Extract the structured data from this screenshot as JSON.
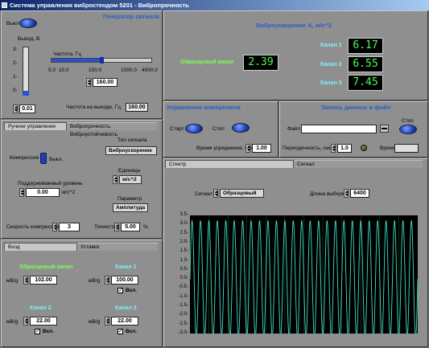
{
  "window": {
    "title": "Система управления вибростендом 5201 - Вибропрочность"
  },
  "generator": {
    "title": "Генератор сигнала",
    "power_label": "Выкл.",
    "output_label": "Выход, В",
    "y_ticks": [
      "3-",
      "2-",
      "1-",
      "0-"
    ],
    "output_value": "0.01",
    "freq_label": "Частота, Гц",
    "freq_ticks": [
      "5.0",
      "10.0",
      "100.0",
      "1000.0",
      "4000.0"
    ],
    "freq_value": "160.00",
    "freq_out_label": "Частота на выходе, Гц",
    "freq_out_value": "160.00"
  },
  "accel": {
    "title": "Виброускорение А, м/с^2",
    "ref_label": "Образцовый канал",
    "ref_value": "2.39",
    "channels": [
      {
        "label": "Канал 1",
        "value": "6.17"
      },
      {
        "label": "Канал 2",
        "value": "6.55"
      },
      {
        "label": "Канал 3",
        "value": "7.45"
      }
    ]
  },
  "measure": {
    "title": "Управление измерением",
    "start_label": "Старт",
    "stop_label": "Стоп",
    "avg_label": "Время усреднения, сек",
    "avg_value": "1.00"
  },
  "record": {
    "title": "Запись данных в файл",
    "stop_label": "Стоп",
    "file_label": "Файл",
    "file_value": "",
    "period_label": "Периодичность, сек",
    "period_value": "1.0",
    "time_label": "Время",
    "time_value": ""
  },
  "control": {
    "tabs": [
      "Ручное управление",
      "Вибропрочность. Виброустойчивость"
    ],
    "compression_label": "Компрессия",
    "off_label": "Выкл.",
    "level_label": "Поддерживаемый уровень",
    "level_value": "0.00",
    "level_unit": "м/с^2",
    "speed_label": "Скорость компрессии",
    "speed_value": "3",
    "signal_type_label": "Тип сигнала",
    "signal_type_value": "Виброускорение",
    "units_label": "Единицы",
    "units_value": "м/с^2",
    "param_label": "Параметр",
    "param_value": "Амплитуда",
    "accuracy_label": "Точность",
    "accuracy_value": "5.00",
    "accuracy_unit": "%"
  },
  "inputs": {
    "tabs": [
      "Вход",
      "Уставки"
    ],
    "unit": "мВ/g",
    "enabled_label": "Вкл.",
    "ref": {
      "label": "Образцовый канал",
      "value": "102.00"
    },
    "ch1": {
      "label": "Канал 1",
      "value": "100.00",
      "checked": "✓"
    },
    "ch2": {
      "label": "Канал 2",
      "value": "22.00",
      "checked": "✓"
    },
    "ch3": {
      "label": "Канал 3",
      "value": "22.00",
      "checked": "✓"
    }
  },
  "plot": {
    "tabs": [
      "Спектр",
      "Сигнал"
    ],
    "signal_label": "Сигнал",
    "signal_value": "Образцовый",
    "length_label": "Длина выборки",
    "length_value": "6400",
    "y_ticks": [
      "3.5-",
      "3.0-",
      "2.5-",
      "2.0-",
      "1.5-",
      "1.0-",
      "0.5-",
      "0.0-",
      "-0.5-",
      "-1.0-",
      "-1.5-",
      "-2.0-",
      "-2.5-",
      "-3.0-"
    ]
  },
  "chart_data": {
    "type": "line",
    "ylim": [
      -3.0,
      3.5
    ],
    "amplitude": 3.2,
    "cycles": 27,
    "series": [
      {
        "color": "#3de0c0"
      }
    ]
  },
  "colors": {
    "trace": "#3de0c0",
    "plot_bg": "#000000",
    "grid": "#1a5a1a",
    "title_blue": "#2a5cc8"
  }
}
